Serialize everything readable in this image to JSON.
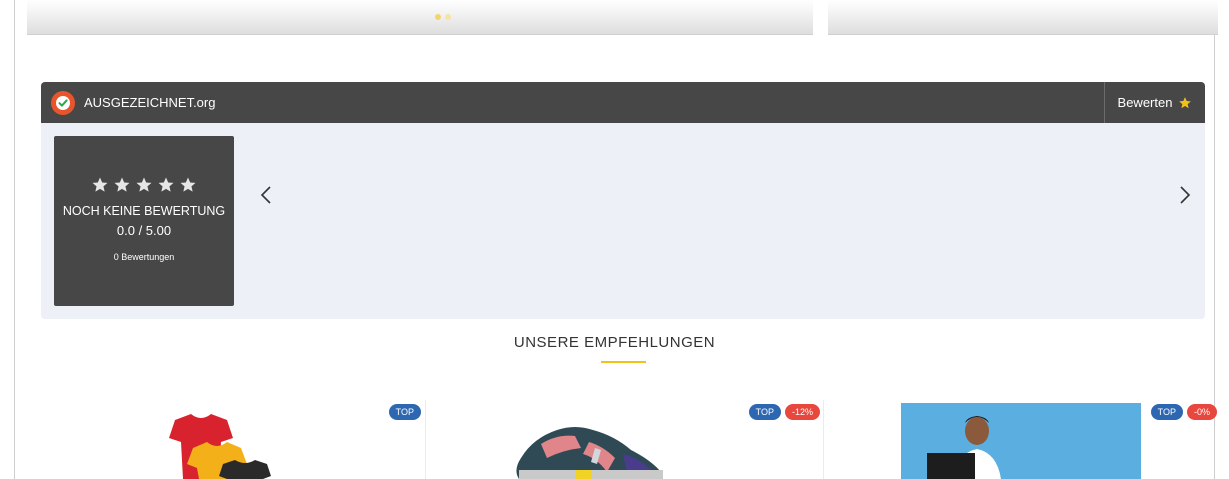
{
  "widget": {
    "brand": "AUSGEZEICHNET.org",
    "rate_label": "Bewerten",
    "no_rating": "NOCH KEINE BEWERTUNG",
    "score": "0.0 / 5.00",
    "count": "0 Bewertungen",
    "stars": 0,
    "icons": {
      "logo": "checkmark-seal-icon",
      "rate": "star-icon",
      "prev": "chevron-left-icon",
      "next": "chevron-right-icon"
    },
    "colors": {
      "header_bg": "#474747",
      "panel_bg": "#eef0f8",
      "star_accent": "#f2c01b",
      "logo_orange": "#e8552d"
    }
  },
  "recommendations": {
    "title": "UNSERE EMPFEHLUNGEN",
    "accent": "#f2c01b",
    "products": [
      {
        "badges": [
          "TOP"
        ]
      },
      {
        "badges": [
          "TOP",
          "-12%"
        ]
      },
      {
        "badges": [
          "TOP",
          "-0%"
        ]
      }
    ]
  }
}
